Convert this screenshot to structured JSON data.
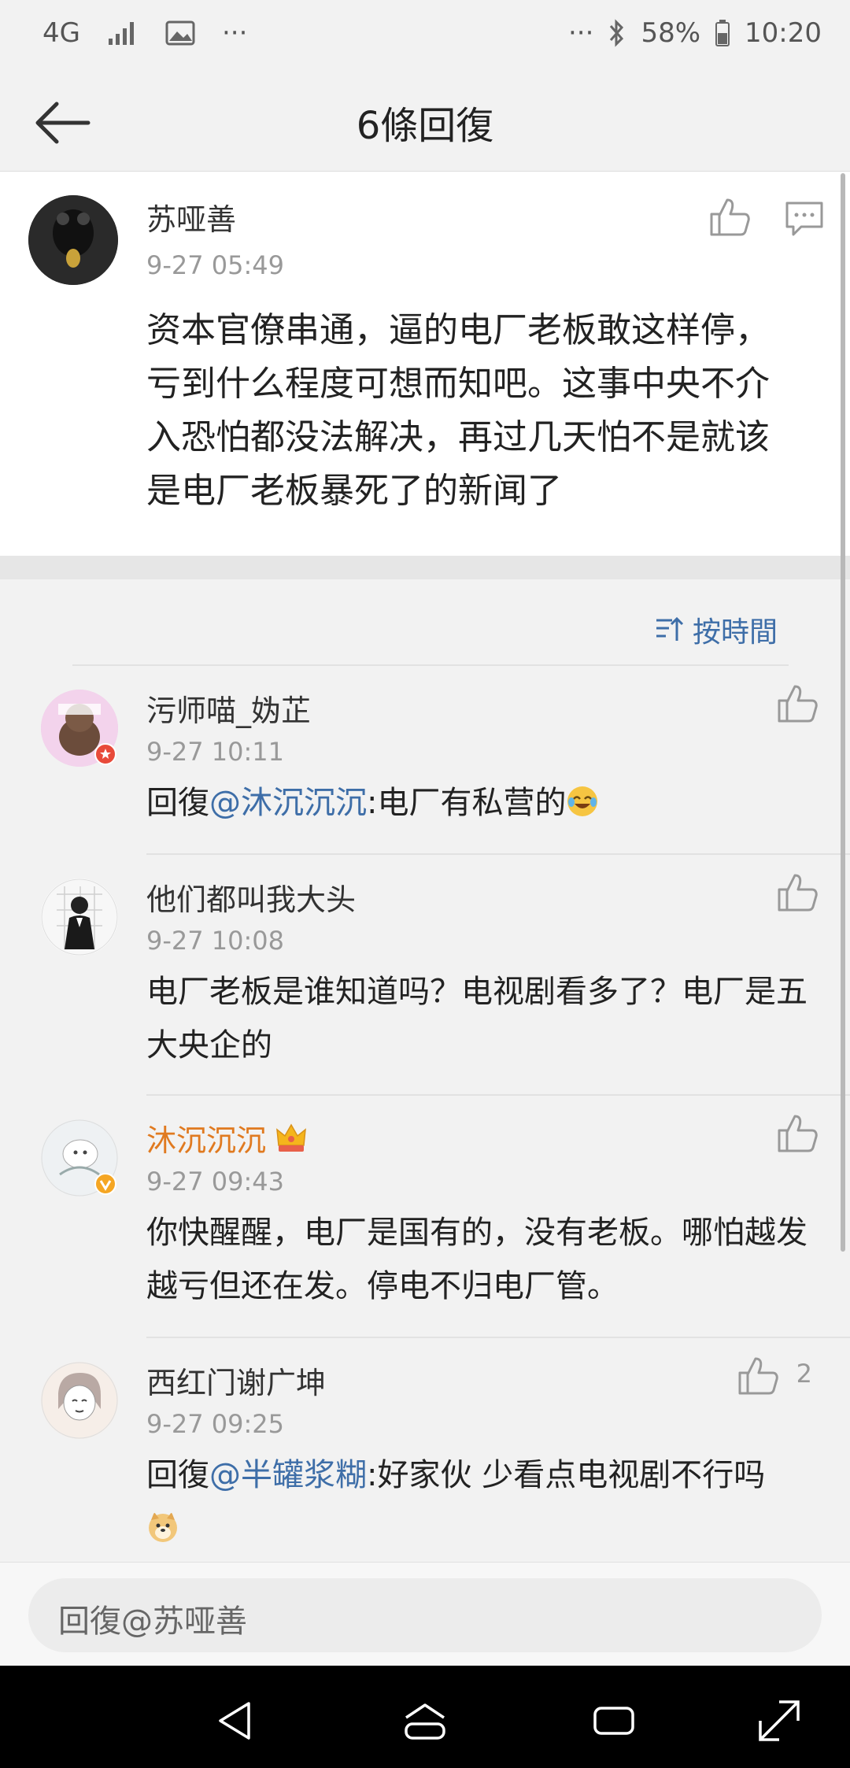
{
  "status_bar": {
    "network": "4G",
    "more_left": "···",
    "more_right": "···",
    "battery": "58%",
    "time": "10:20"
  },
  "header": {
    "title": "6條回復"
  },
  "main_comment": {
    "author": "苏哑善",
    "time": "9-27 05:49",
    "text": "资本官僚串通，逼的电厂老板敢这样停，亏到什么程度可想而知吧。这事中央不介入恐怕都没法解决，再过几天怕不是就该是电厂老板暴死了的新闻了"
  },
  "sort": {
    "label": "按時間"
  },
  "replies": [
    {
      "author": "污师喵_妫芷",
      "time": "9-27 10:11",
      "prefix": "回復",
      "mention": "@沐沉沉沉",
      "text": ":电厂有私营的"
    },
    {
      "author": "他们都叫我大头",
      "time": "9-27 10:08",
      "text": "电厂老板是谁知道吗？电视剧看多了？电厂是五大央企的"
    },
    {
      "author": "沐沉沉沉",
      "author_color": "#e07a20",
      "time": "9-27 09:43",
      "text": "你快醒醒，电厂是国有的，没有老板。哪怕越发越亏但还在发。停电不归电厂管。"
    },
    {
      "author": "西红门谢广坤",
      "time": "9-27 09:25",
      "like_count": "2",
      "prefix": "回復",
      "mention": "@半罐浆糊",
      "text": ":好家伙 少看点电视剧不行吗"
    }
  ],
  "input": {
    "placeholder": "回復@苏哑善"
  },
  "colors": {
    "link": "#3e6ea8",
    "vip_name": "#e07a20"
  }
}
